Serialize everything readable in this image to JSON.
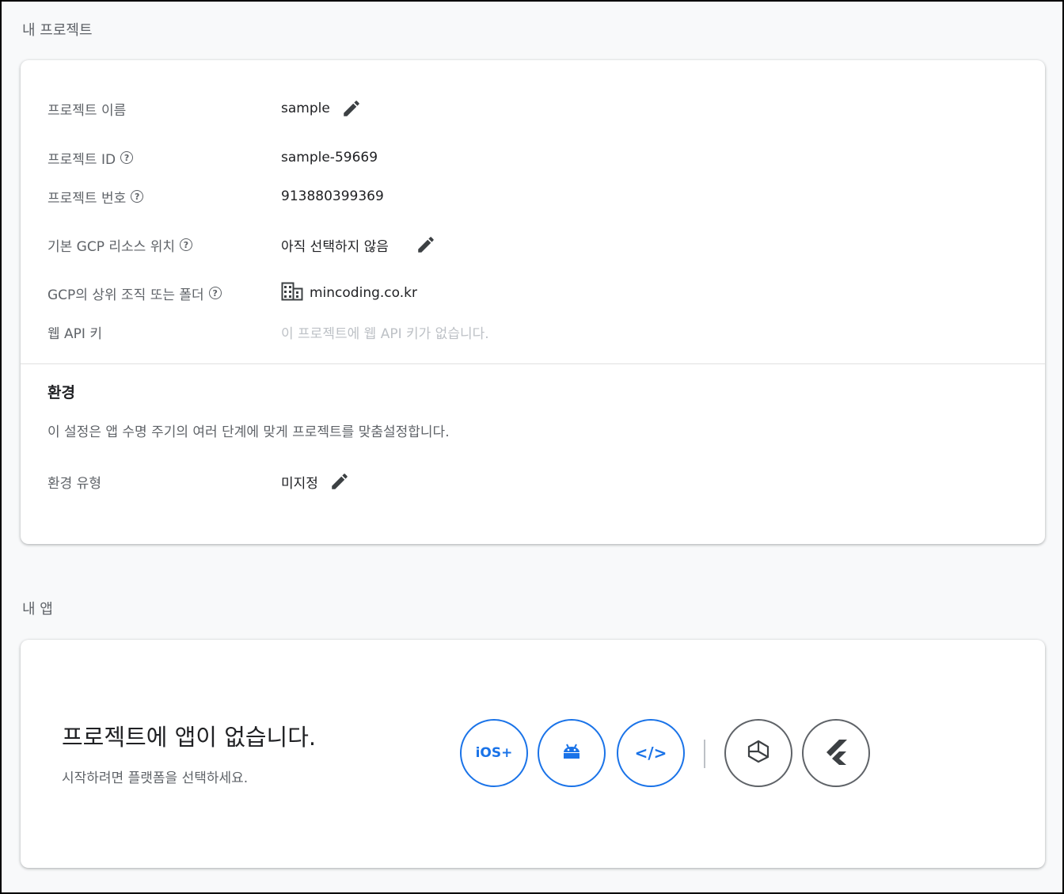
{
  "project_section": {
    "title": "내 프로젝트",
    "rows": {
      "name": {
        "label": "프로젝트 이름",
        "value": "sample"
      },
      "id": {
        "label": "프로젝트 ID",
        "value": "sample-59669"
      },
      "number": {
        "label": "프로젝트 번호",
        "value": "913880399369"
      },
      "location": {
        "label": "기본 GCP 리소스 위치",
        "value": "아직 선택하지 않음"
      },
      "parent": {
        "label": "GCP의 상위 조직 또는 폴더",
        "value": "mincoding.co.kr"
      },
      "api_key": {
        "label": "웹 API 키",
        "value": "이 프로젝트에 웹 API 키가 없습니다."
      }
    },
    "environment": {
      "title": "환경",
      "description": "이 설정은 앱 수명 주기의 여러 단계에 맞게 프로젝트를 맞춤설정합니다.",
      "type_label": "환경 유형",
      "type_value": "미지정"
    }
  },
  "apps_section": {
    "title": "내 앱",
    "empty_title": "프로젝트에 앱이 없습니다.",
    "empty_subtitle": "시작하려면 플랫폼을 선택하세요.",
    "platforms": {
      "ios": "iOS+",
      "android": "android-icon",
      "web": "</>",
      "unity": "unity-icon",
      "flutter": "flutter-icon"
    }
  },
  "colors": {
    "accent": "#1a73e8",
    "muted": "#bdc1c6",
    "text": "#202124",
    "secondary": "#5f6368"
  }
}
